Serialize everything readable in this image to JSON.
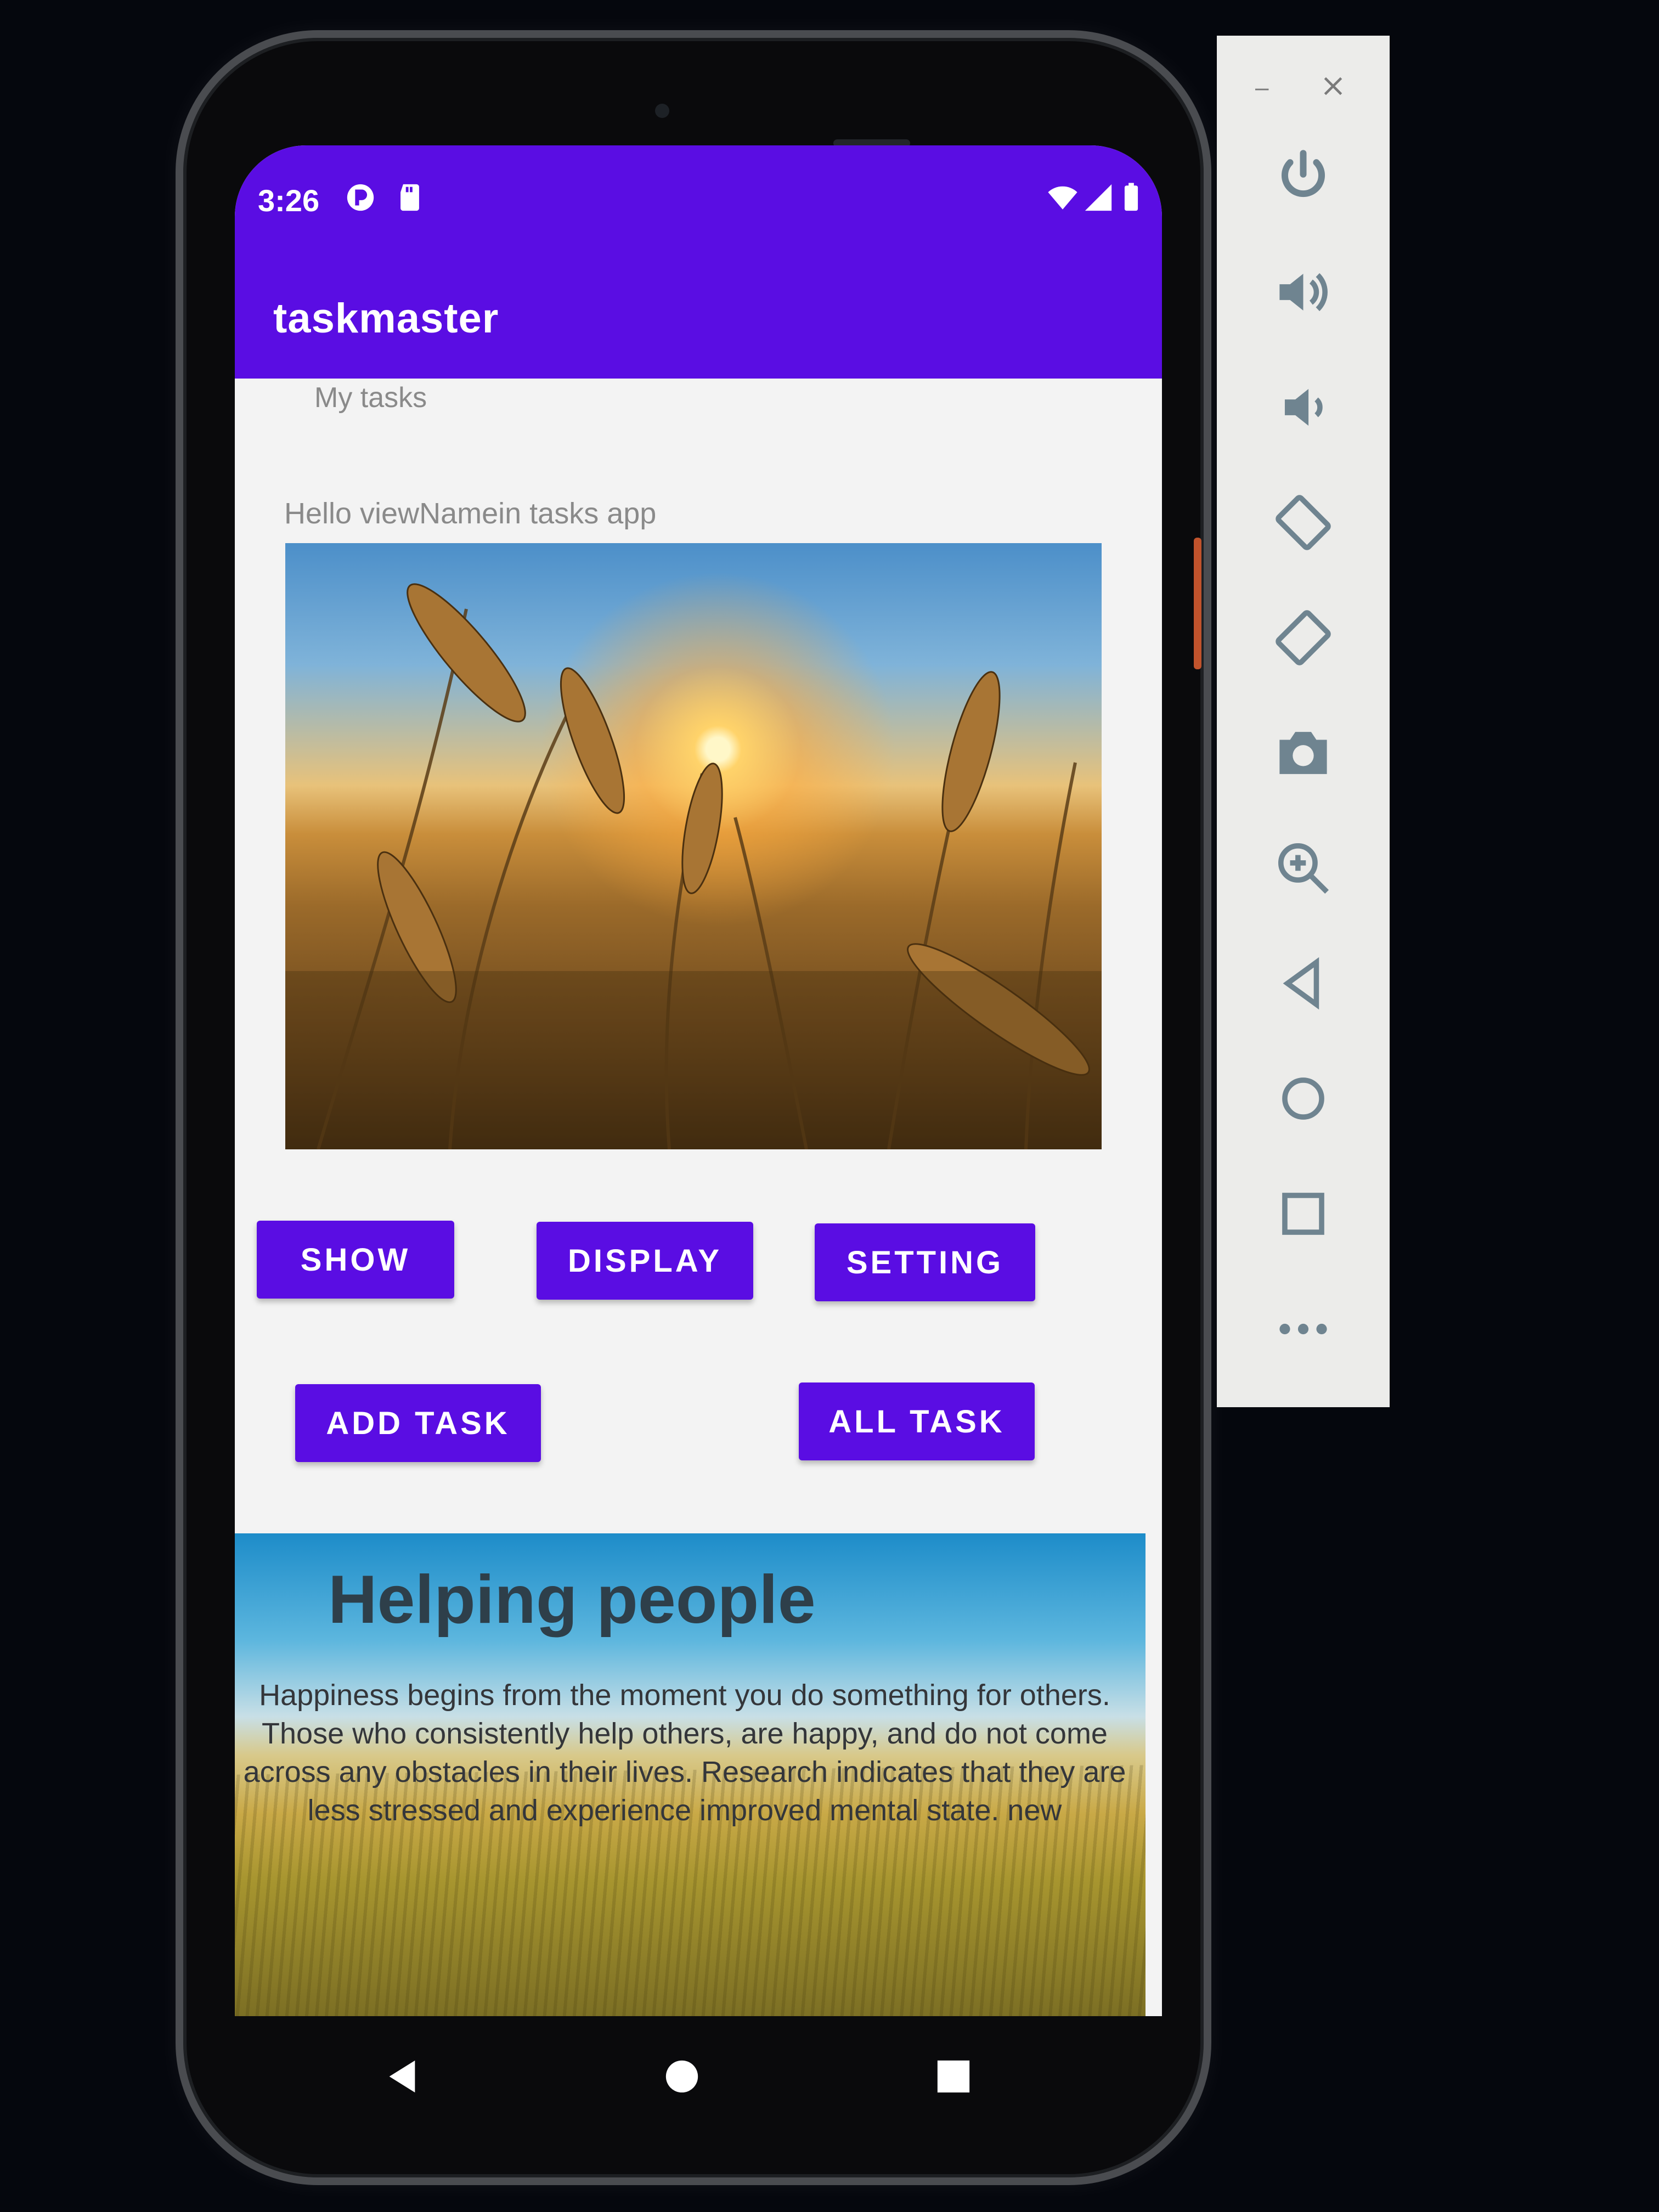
{
  "status_bar": {
    "time": "3:26"
  },
  "app_bar": {
    "title": "taskmaster"
  },
  "content": {
    "subtitle": "My tasks",
    "greeting": "Hello viewNamein tasks app"
  },
  "buttons": {
    "show": "SHOW",
    "display": "DISPLAY",
    "setting": "SETTING",
    "add_task": "ADD TASK",
    "all_task": "ALL TASK"
  },
  "banner": {
    "title": "Helping people",
    "text": "Happiness begins from the moment you do something for others. Those who consistently help others, are happy, and do not come across any obstacles in their lives. Research indicates that they are less stressed and experience improved mental state. new"
  },
  "emulator_toolbar": {
    "items": [
      "minimize-icon",
      "close-icon",
      "power-icon",
      "volume-up-icon",
      "volume-down-icon",
      "rotate-left-icon",
      "rotate-right-icon",
      "camera-icon",
      "zoom-icon",
      "back-icon",
      "home-icon",
      "overview-icon",
      "more-icon"
    ]
  },
  "colors": {
    "primary": "#5a0de3",
    "screen_bg": "#f3f3f3",
    "toolbar_bg": "#ececea"
  }
}
